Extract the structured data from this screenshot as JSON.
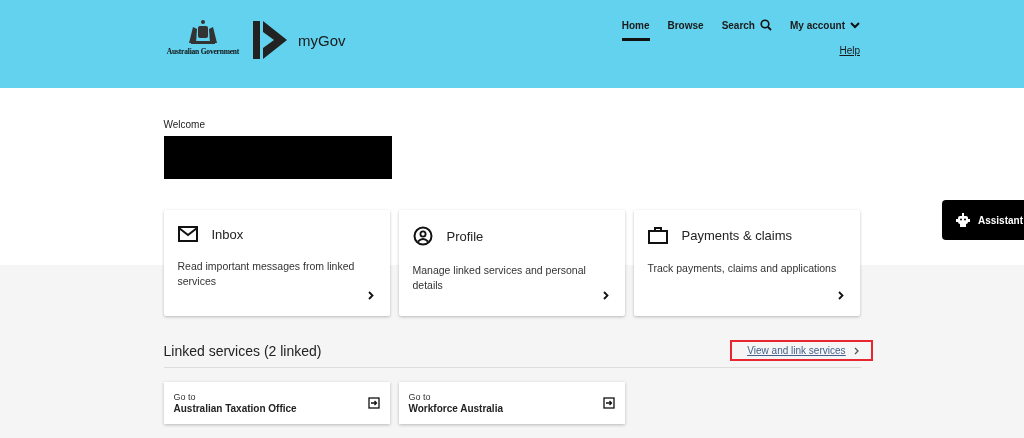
{
  "header": {
    "government": "Australian Government",
    "brand": "myGov",
    "nav": [
      {
        "label": "Home",
        "selected": true
      },
      {
        "label": "Browse",
        "selected": false
      },
      {
        "label": "Search",
        "selected": false,
        "kind": "search"
      },
      {
        "label": "My account",
        "selected": false,
        "kind": "menu"
      }
    ],
    "help": "Help"
  },
  "welcome": {
    "label": "Welcome",
    "name_redacted": true
  },
  "cards": [
    {
      "kind": "inbox",
      "title": "Inbox",
      "description": "Read important messages from linked services"
    },
    {
      "kind": "profile",
      "title": "Profile",
      "description": "Manage linked services and personal details"
    },
    {
      "kind": "payments",
      "title": "Payments & claims",
      "description": "Track payments, claims and applications"
    }
  ],
  "linked": {
    "heading": "Linked services (2 linked)",
    "link": "View and link services",
    "link_highlighted": true,
    "services": [
      {
        "prefix": "Go to",
        "name": "Australian Taxation Office"
      },
      {
        "prefix": "Go to",
        "name": "Workforce Australia"
      }
    ]
  },
  "assistant": {
    "label": "Assistant"
  }
}
